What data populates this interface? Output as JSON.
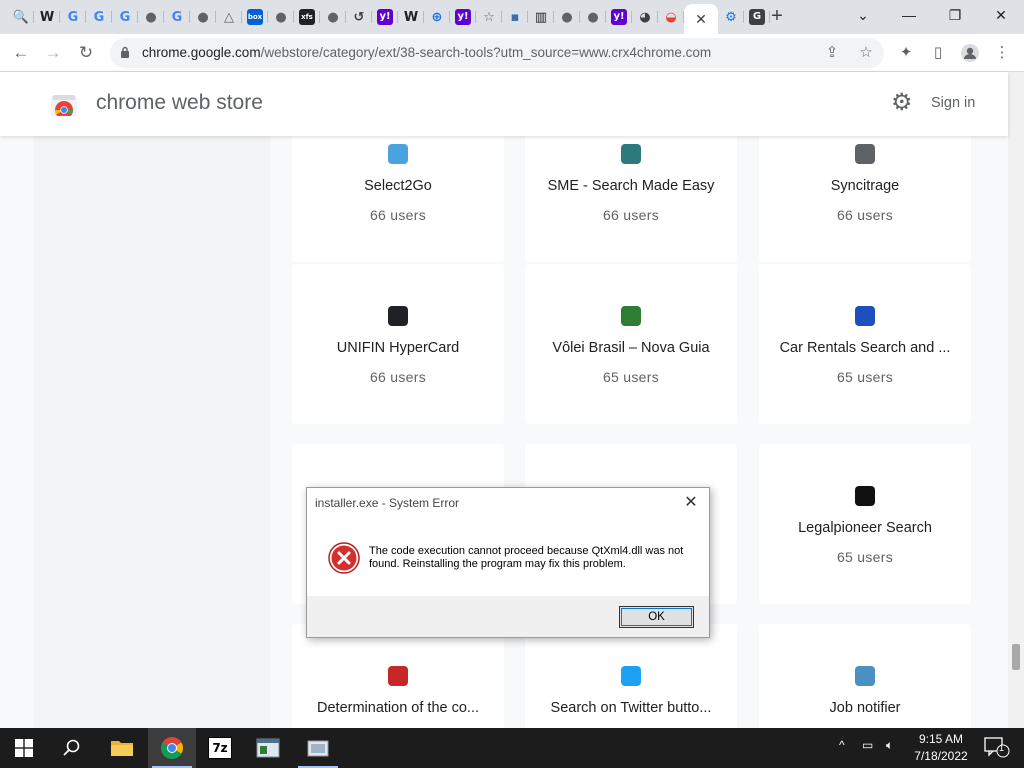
{
  "browser": {
    "tab_favicons": [
      {
        "name": "search",
        "glyph": "🔍",
        "bg": "transparent",
        "fg": "#1a73e8"
      },
      {
        "name": "wikipedia",
        "glyph": "W",
        "bg": "transparent",
        "fg": "#202124"
      },
      {
        "name": "google",
        "glyph": "G",
        "bg": "transparent",
        "fg": "#4285f4"
      },
      {
        "name": "google",
        "glyph": "G",
        "bg": "transparent",
        "fg": "#4285f4"
      },
      {
        "name": "google",
        "glyph": "G",
        "bg": "transparent",
        "fg": "#4285f4"
      },
      {
        "name": "globe",
        "glyph": "●",
        "bg": "transparent",
        "fg": "#5f6368"
      },
      {
        "name": "google",
        "glyph": "G",
        "bg": "transparent",
        "fg": "#4285f4"
      },
      {
        "name": "globe",
        "glyph": "●",
        "bg": "transparent",
        "fg": "#5f6368"
      },
      {
        "name": "drive",
        "glyph": "△",
        "bg": "transparent",
        "fg": "#5f6368"
      },
      {
        "name": "box",
        "glyph": "box",
        "bg": "#0061d5",
        "fg": "#ffffff"
      },
      {
        "name": "globe",
        "glyph": "●",
        "bg": "transparent",
        "fg": "#5f6368"
      },
      {
        "name": "xfs",
        "glyph": "xfs",
        "bg": "#202124",
        "fg": "#ffffff"
      },
      {
        "name": "globe",
        "glyph": "●",
        "bg": "transparent",
        "fg": "#5f6368"
      },
      {
        "name": "history",
        "glyph": "↺",
        "bg": "transparent",
        "fg": "#3c4043"
      },
      {
        "name": "yahoo",
        "glyph": "y!",
        "bg": "#6001d2",
        "fg": "#ffffff"
      },
      {
        "name": "wikipedia",
        "glyph": "W",
        "bg": "transparent",
        "fg": "#202124"
      },
      {
        "name": "web",
        "glyph": "⊕",
        "bg": "transparent",
        "fg": "#1a73e8"
      },
      {
        "name": "yahoo",
        "glyph": "y!",
        "bg": "#6001d2",
        "fg": "#ffffff"
      },
      {
        "name": "star",
        "glyph": "☆",
        "bg": "transparent",
        "fg": "#5f6368"
      },
      {
        "name": "app",
        "glyph": "▪",
        "bg": "transparent",
        "fg": "#3a6ea5"
      },
      {
        "name": "library",
        "glyph": "▥",
        "bg": "transparent",
        "fg": "#202124"
      },
      {
        "name": "globe",
        "glyph": "●",
        "bg": "transparent",
        "fg": "#5f6368"
      },
      {
        "name": "globe",
        "glyph": "●",
        "bg": "transparent",
        "fg": "#5f6368"
      },
      {
        "name": "yahoo",
        "glyph": "y!",
        "bg": "#6001d2",
        "fg": "#ffffff"
      },
      {
        "name": "globe-dark",
        "glyph": "◕",
        "bg": "transparent",
        "fg": "#3c4043"
      },
      {
        "name": "webstore",
        "glyph": "◒",
        "bg": "transparent",
        "fg": "#ea4335"
      }
    ],
    "active_tab_close": "✕",
    "tabs_after_active": [
      {
        "name": "settings",
        "glyph": "⚙",
        "bg": "transparent",
        "fg": "#1a73e8"
      },
      {
        "name": "grammarly",
        "glyph": "G",
        "bg": "#3c4043",
        "fg": "#ffffff"
      }
    ],
    "new_tab": "+",
    "window_controls": {
      "dropdown": "⌄",
      "minimize": "—",
      "restore": "❐",
      "close": "✕"
    },
    "url_host": "chrome.google.com",
    "url_path": "/webstore/category/ext/38-search-tools?utm_source=www.crx4chrome.com"
  },
  "store": {
    "title": "chrome web store",
    "signin": "Sign in"
  },
  "cards": [
    {
      "name": "Select2Go",
      "users": "66 users",
      "icon": "select2go",
      "color": "#4aa3df"
    },
    {
      "name": "SME - Search Made Easy",
      "users": "66 users",
      "icon": "sme",
      "color": "#2c7a7b"
    },
    {
      "name": "Syncitrage",
      "users": "66 users",
      "icon": "syncitrage",
      "color": "#5f6368"
    },
    {
      "name": "UNIFIN HyperCard",
      "users": "66 users",
      "icon": "unifin",
      "color": "#202124"
    },
    {
      "name": "Vôlei Brasil – Nova Guia",
      "users": "65 users",
      "icon": "volei",
      "color": "#2e7d32"
    },
    {
      "name": "Car Rentals Search and ...",
      "users": "65 users",
      "icon": "car-rentals",
      "color": "#1e4fbf"
    },
    {
      "name": "",
      "users": "",
      "icon": "",
      "color": "#ffffff"
    },
    {
      "name": "",
      "users": "",
      "icon": "",
      "color": "#ffffff"
    },
    {
      "name": "Legalpioneer Search",
      "users": "65 users",
      "icon": "legalpioneer",
      "color": "#111111"
    },
    {
      "name": "Determination of the co...",
      "users": "",
      "icon": "map-pin",
      "color": "#c62828"
    },
    {
      "name": "Search on Twitter butto...",
      "users": "",
      "icon": "twitter",
      "color": "#1da1f2"
    },
    {
      "name": "Job notifier",
      "users": "",
      "icon": "briefcase",
      "color": "#4a90c2"
    }
  ],
  "dialog": {
    "title": "installer.exe - System Error",
    "message": "The code execution cannot proceed because QtXml4.dll was not found. Reinstalling the program may fix this problem.",
    "ok_label": "OK",
    "close_glyph": "✕"
  },
  "taskbar": {
    "time": "9:15 AM",
    "date": "7/18/2022",
    "notification_count": "1",
    "seven_zip_label": "7z"
  }
}
